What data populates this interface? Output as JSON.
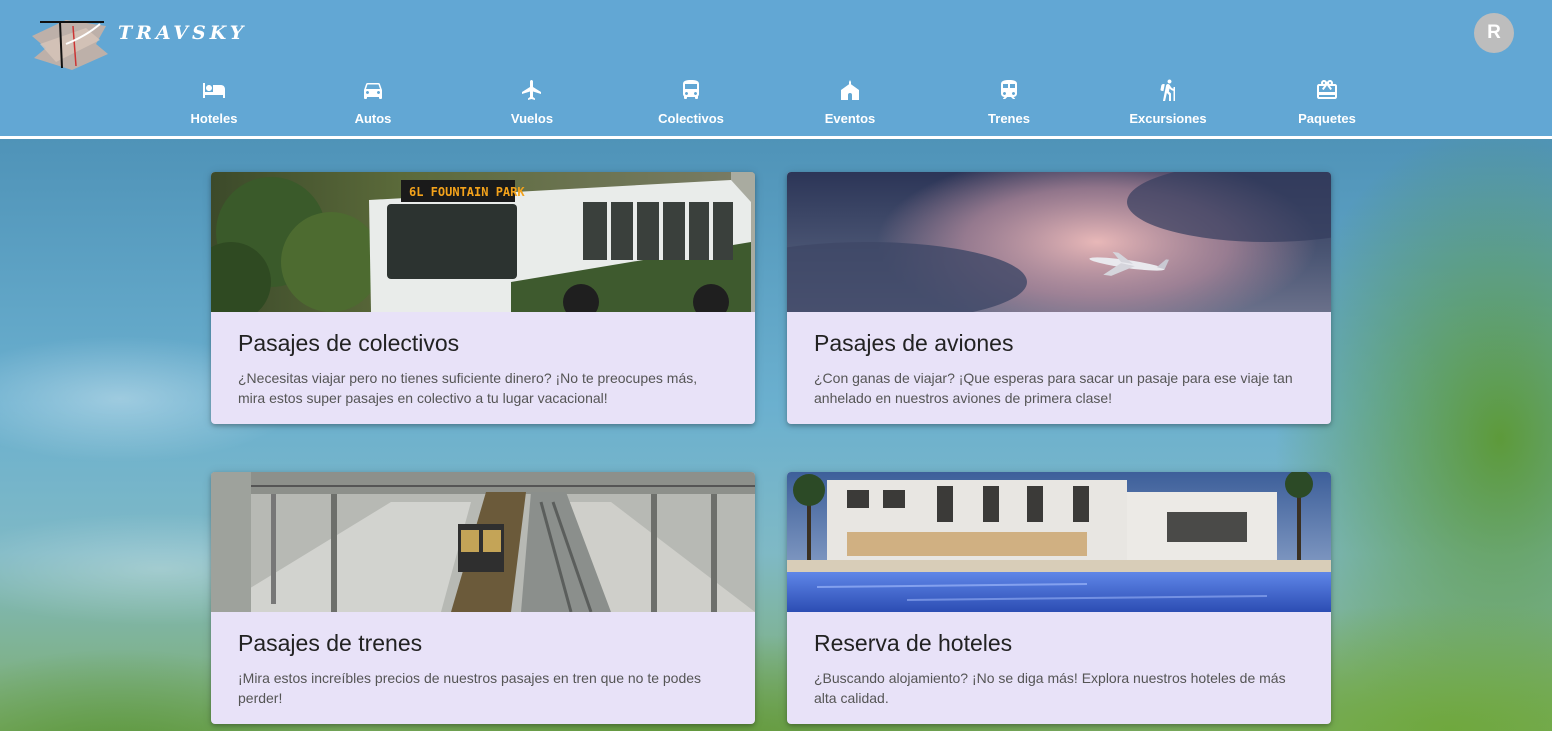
{
  "brand": {
    "name": "TRAVSKY"
  },
  "user": {
    "avatar_initial": "R"
  },
  "nav": [
    {
      "label": "Hoteles",
      "icon": "bed-icon"
    },
    {
      "label": "Autos",
      "icon": "car-icon"
    },
    {
      "label": "Vuelos",
      "icon": "airplane-icon"
    },
    {
      "label": "Colectivos",
      "icon": "bus-icon"
    },
    {
      "label": "Eventos",
      "icon": "venue-icon"
    },
    {
      "label": "Trenes",
      "icon": "train-icon"
    },
    {
      "label": "Excursiones",
      "icon": "hiking-icon"
    },
    {
      "label": "Paquetes",
      "icon": "package-icon"
    }
  ],
  "cards": [
    {
      "title": "Pasajes de colectivos",
      "description": "¿Necesitas viajar pero no tienes suficiente dinero? ¡No te preocupes más, mira estos super pasajes en colectivo a tu lugar vacacional!",
      "image": "bus-photo",
      "image_sign": "6L FOUNTAIN PARK"
    },
    {
      "title": "Pasajes de aviones",
      "description": "¿Con ganas de viajar? ¡Que esperas para sacar un pasaje para ese viaje tan anhelado en nuestros aviones de primera clase!",
      "image": "airplane-sky-photo"
    },
    {
      "title": "Pasajes de trenes",
      "description": "¡Mira estos increíbles precios de nuestros pasajes en tren que no te podes perder!",
      "image": "train-station-photo"
    },
    {
      "title": "Reserva de hoteles",
      "description": "¿Buscando alojamiento? ¡No se diga más! Explora nuestros hoteles de más alta calidad.",
      "image": "hotel-pool-photo"
    }
  ],
  "colors": {
    "header": "#62a7d4",
    "card_background": "#e8e2f8",
    "avatar": "#bdbdbd"
  }
}
